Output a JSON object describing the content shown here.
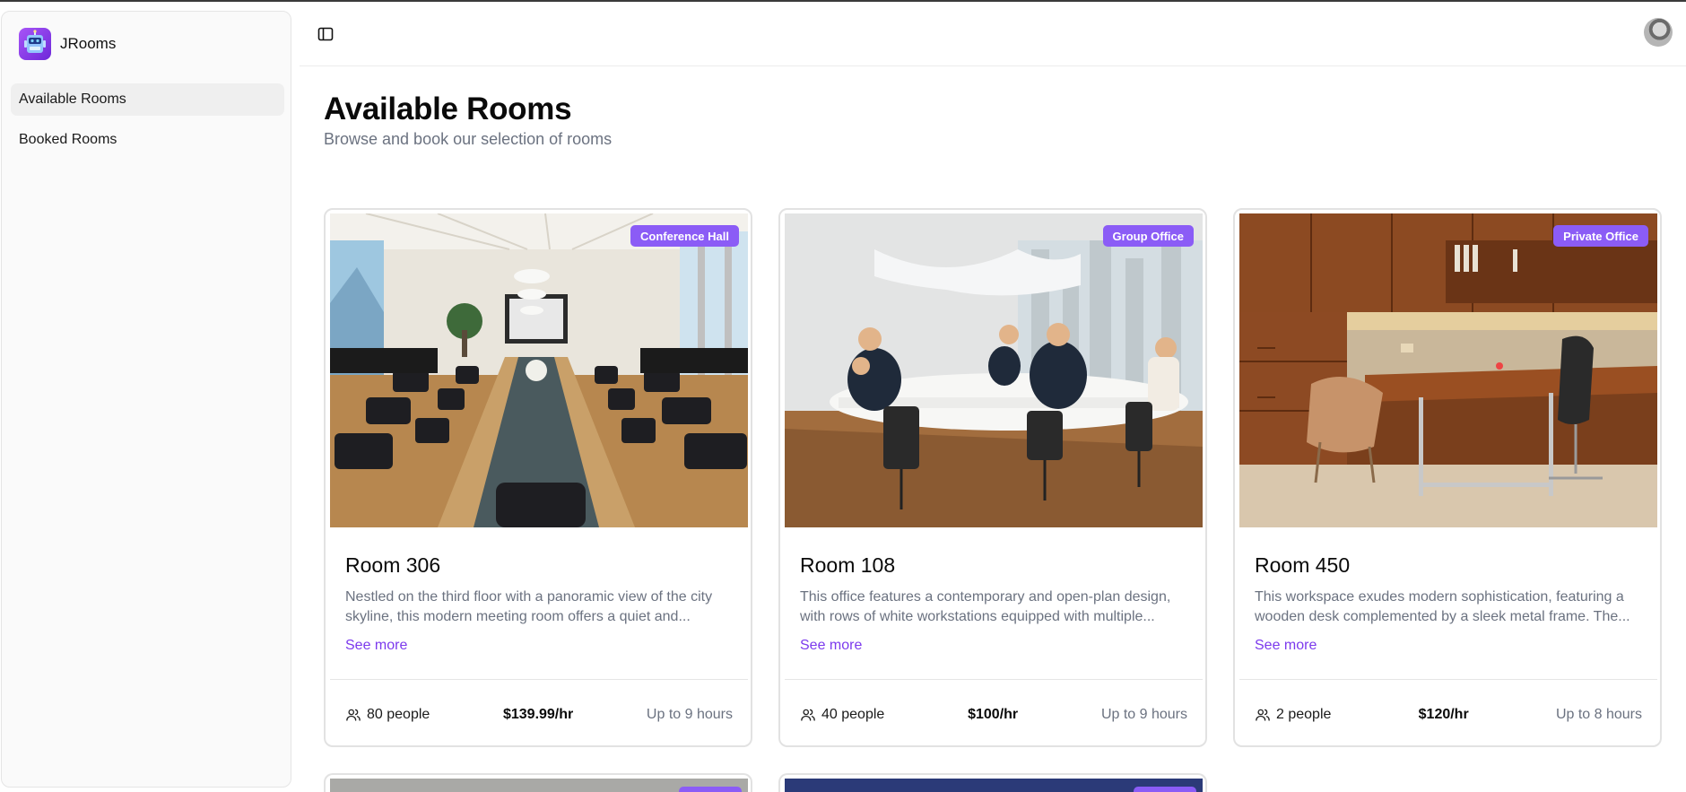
{
  "app": {
    "name": "JRooms"
  },
  "sidebar": {
    "items": [
      {
        "label": "Available Rooms",
        "active": true
      },
      {
        "label": "Booked Rooms",
        "active": false
      }
    ]
  },
  "header": {
    "toggle_icon": "sidebar-toggle-icon",
    "avatar": "user-avatar"
  },
  "page": {
    "title": "Available Rooms",
    "subtitle": "Browse and book our selection of rooms"
  },
  "rooms": [
    {
      "badge": "Conference Hall",
      "title": "Room 306",
      "description": "Nestled on the third floor with a panoramic view of the city skyline, this modern meeting room offers a quiet and...",
      "see_more": "See more",
      "capacity": "80 people",
      "price": "$139.99/hr",
      "hours": "Up to 9 hours"
    },
    {
      "badge": "Group Office",
      "title": "Room 108",
      "description": "This office features a contemporary and open-plan design, with rows of white workstations equipped with multiple...",
      "see_more": "See more",
      "capacity": "40 people",
      "price": "$100/hr",
      "hours": "Up to 9 hours"
    },
    {
      "badge": "Private Office",
      "title": "Room 450",
      "description": "This workspace exudes modern sophistication, featuring a wooden desk complemented by a sleek metal frame. The...",
      "see_more": "See more",
      "capacity": "2 people",
      "price": "$120/hr",
      "hours": "Up to 8 hours"
    }
  ],
  "colors": {
    "accent": "#8b5cf6",
    "link": "#7c3aed",
    "muted": "#6b7280"
  }
}
